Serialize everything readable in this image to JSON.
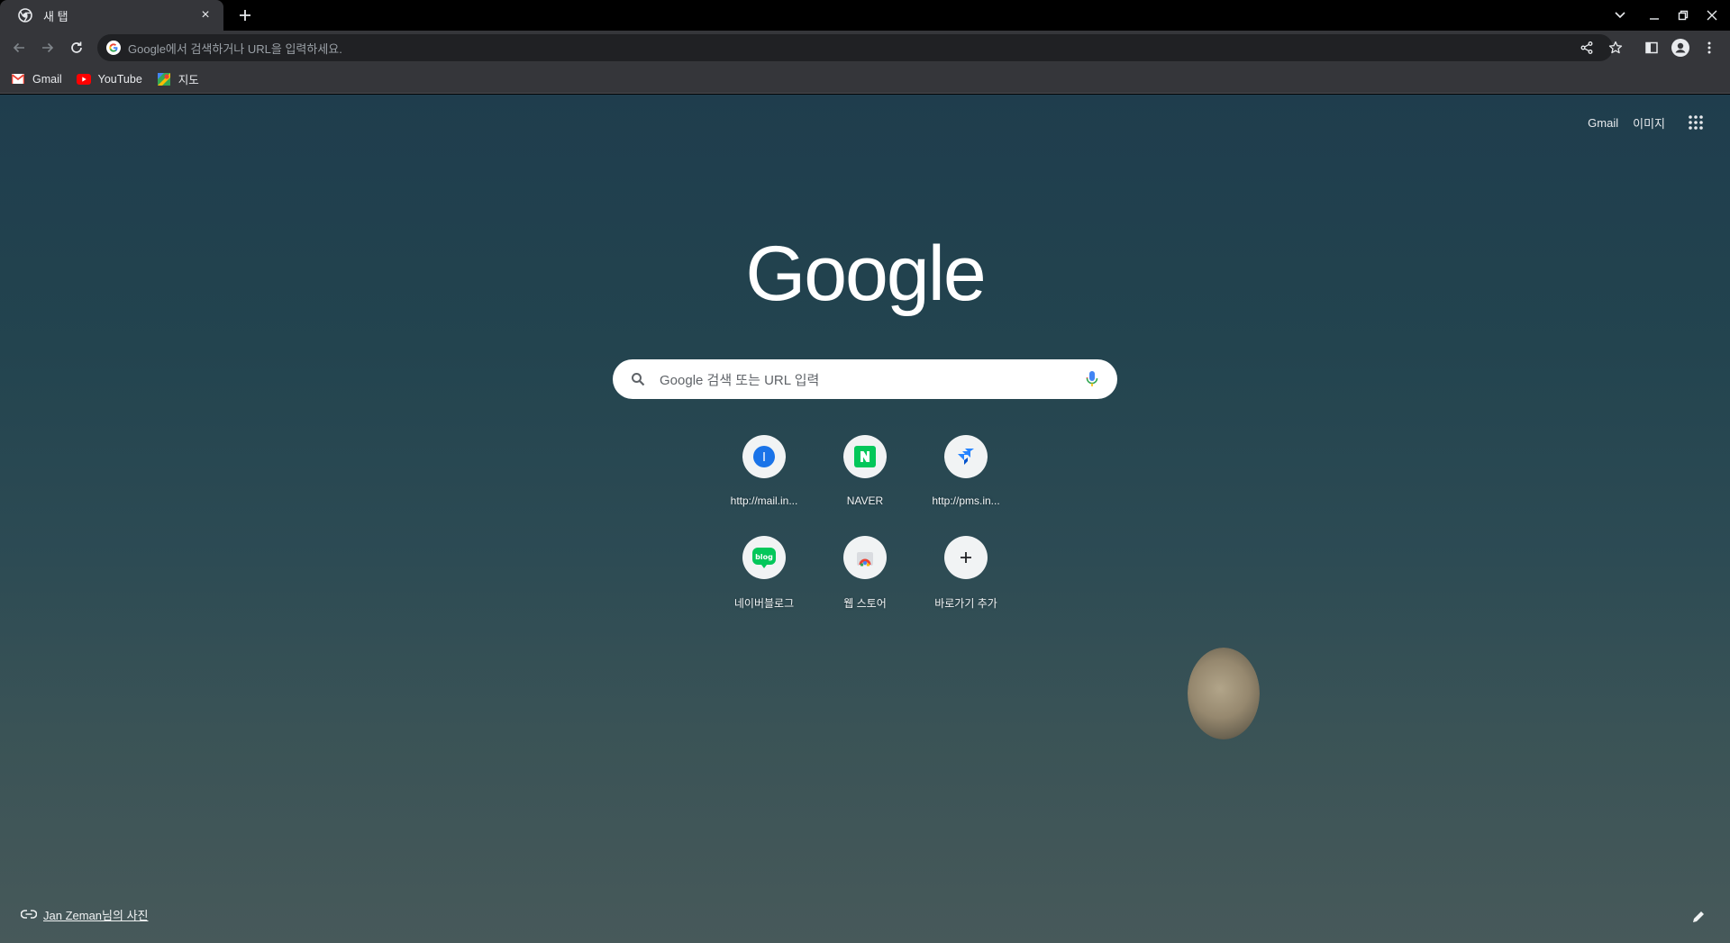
{
  "tab": {
    "title": "새 탭",
    "close_glyph": "×"
  },
  "newtab_glyph": "+",
  "omnibox": {
    "placeholder": "Google에서 검색하거나 URL을 입력하세요."
  },
  "bookmarks": [
    {
      "label": "Gmail",
      "icon": "gmail-icon"
    },
    {
      "label": "YouTube",
      "icon": "youtube-icon"
    },
    {
      "label": "지도",
      "icon": "maps-icon"
    }
  ],
  "ntp": {
    "top_links": {
      "gmail": "Gmail",
      "images": "이미지"
    },
    "logo": "Google",
    "search_placeholder": "Google 검색 또는 URL 입력",
    "shortcuts": [
      {
        "label": "http://mail.in...",
        "icon": "mail-site-icon"
      },
      {
        "label": "NAVER",
        "icon": "naver-icon"
      },
      {
        "label": "http://pms.in...",
        "icon": "jira-icon"
      },
      {
        "label": "네이버블로그",
        "icon": "naver-blog-icon"
      },
      {
        "label": "웹 스토어",
        "icon": "chrome-web-store-icon"
      },
      {
        "label": "바로가기 추가",
        "icon": "add-icon"
      }
    ],
    "attribution": "Jan Zeman님의 사진"
  },
  "colors": {
    "tab_bg": "#35363a",
    "toolbar_bg": "#35363a",
    "omnibox_bg": "#202124",
    "text": "#e8eaed",
    "naver_green": "#03c75a",
    "google_blue": "#4285f4"
  }
}
